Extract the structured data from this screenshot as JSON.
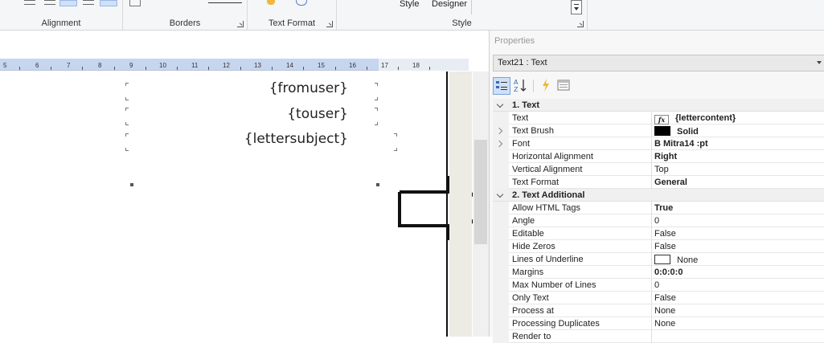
{
  "ribbon": {
    "groups": {
      "alignment": "Alignment",
      "borders": "Borders",
      "text_format": "Text Format",
      "style": "Style"
    },
    "style_buttons": {
      "style": "Style",
      "designer": "Designer"
    }
  },
  "report": {
    "ruler_ticks": [
      "5",
      "6",
      "7",
      "8",
      "9",
      "10",
      "11",
      "12",
      "13",
      "14",
      "15",
      "16",
      "17",
      "18"
    ],
    "fields": [
      "{fromuser}",
      "{touser}",
      "{lettersubject}"
    ]
  },
  "properties": {
    "title": "Properties",
    "selected_object": "Text21 : Text",
    "categories": [
      {
        "label": "1. Text",
        "rows": [
          {
            "name": "Text",
            "value": "{lettercontent}",
            "bold": true,
            "icon": "fx-icon"
          },
          {
            "name": "Text Brush",
            "value": "Solid",
            "bold": true,
            "swatch": "#000000",
            "expandable": true
          },
          {
            "name": "Font",
            "value": "B Mitra14 :pt",
            "bold": true,
            "expandable": true
          },
          {
            "name": "Horizontal Alignment",
            "value": "Right",
            "bold": true
          },
          {
            "name": "Vertical Alignment",
            "value": "Top"
          },
          {
            "name": "Text Format",
            "value": "General",
            "bold": true
          }
        ]
      },
      {
        "label": "2. Text  Additional",
        "rows": [
          {
            "name": "Allow HTML Tags",
            "value": "True",
            "bold": true
          },
          {
            "name": "Angle",
            "value": "0"
          },
          {
            "name": "Editable",
            "value": "False"
          },
          {
            "name": "Hide Zeros",
            "value": "False"
          },
          {
            "name": "Lines of Underline",
            "value": "None",
            "swatch": "#ffffff"
          },
          {
            "name": "Margins",
            "value": "0:0:0:0",
            "bold": true
          },
          {
            "name": "Max Number of Lines",
            "value": "0"
          },
          {
            "name": "Only Text",
            "value": "False"
          },
          {
            "name": "Process at",
            "value": "None"
          },
          {
            "name": "Processing Duplicates",
            "value": "None"
          },
          {
            "name": "Render to",
            "value": ""
          }
        ]
      }
    ]
  },
  "colors": {
    "ruler": "#c7d6ef",
    "gutter": "#ecebe4",
    "selected_button": "#cfe0f7"
  }
}
